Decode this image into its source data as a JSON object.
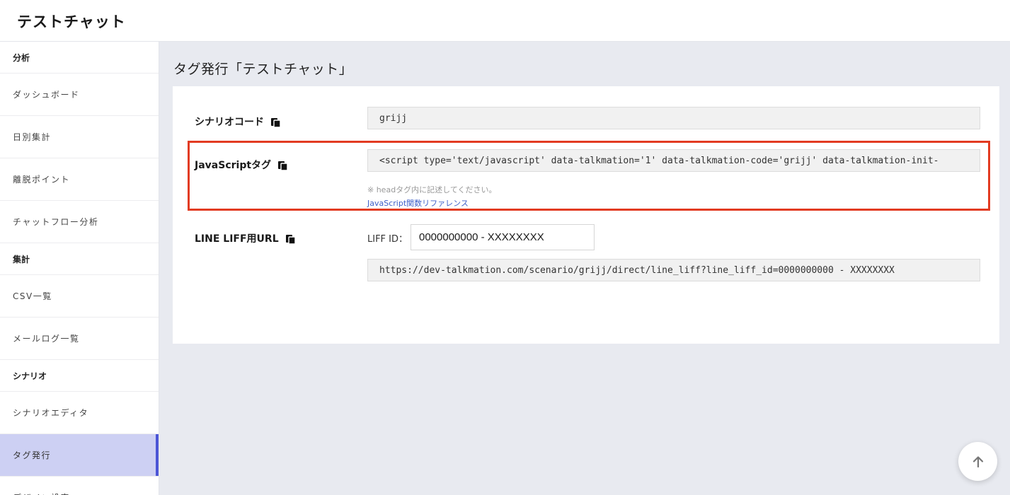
{
  "app": {
    "title": "テストチャット"
  },
  "sidebar": {
    "sections": [
      {
        "title": "分析",
        "items": [
          "ダッシュボード",
          "日別集計",
          "離脱ポイント",
          "チャットフロー分析"
        ]
      },
      {
        "title": "集計",
        "items": [
          "CSV一覧",
          "メールログ一覧"
        ]
      },
      {
        "title": "シナリオ",
        "items": [
          "シナリオエディタ",
          "タグ発行",
          "デザイン設定"
        ]
      }
    ],
    "active": "タグ発行"
  },
  "page": {
    "title": "タグ発行「テストチャット」"
  },
  "fields": {
    "scenario_code": {
      "label": "シナリオコード",
      "value": "grijj"
    },
    "js_tag": {
      "label": "JavaScriptタグ",
      "value": "<script type='text/javascript' data-talkmation='1' data-talkmation-code='grijj' data-talkmation-init-",
      "note": "※ headタグ内に記述してください。",
      "link": "JavaScript関数リファレンス"
    },
    "liff_url": {
      "label": "LINE LIFF用URL",
      "liff_id_label": "LIFF ID：",
      "liff_id_value": "0000000000 - XXXXXXXX",
      "value": "https://dev-talkmation.com/scenario/grijj/direct/line_liff?line_liff_id=0000000000 - XXXXXXXX"
    }
  },
  "icons": {
    "copy": "copy-icon",
    "scroll_top": "arrow-up-icon"
  },
  "colors": {
    "accent": "#4b55d6",
    "active_bg": "#cdd0f3",
    "highlight": "#e23b22",
    "link": "#3d5fc8"
  }
}
